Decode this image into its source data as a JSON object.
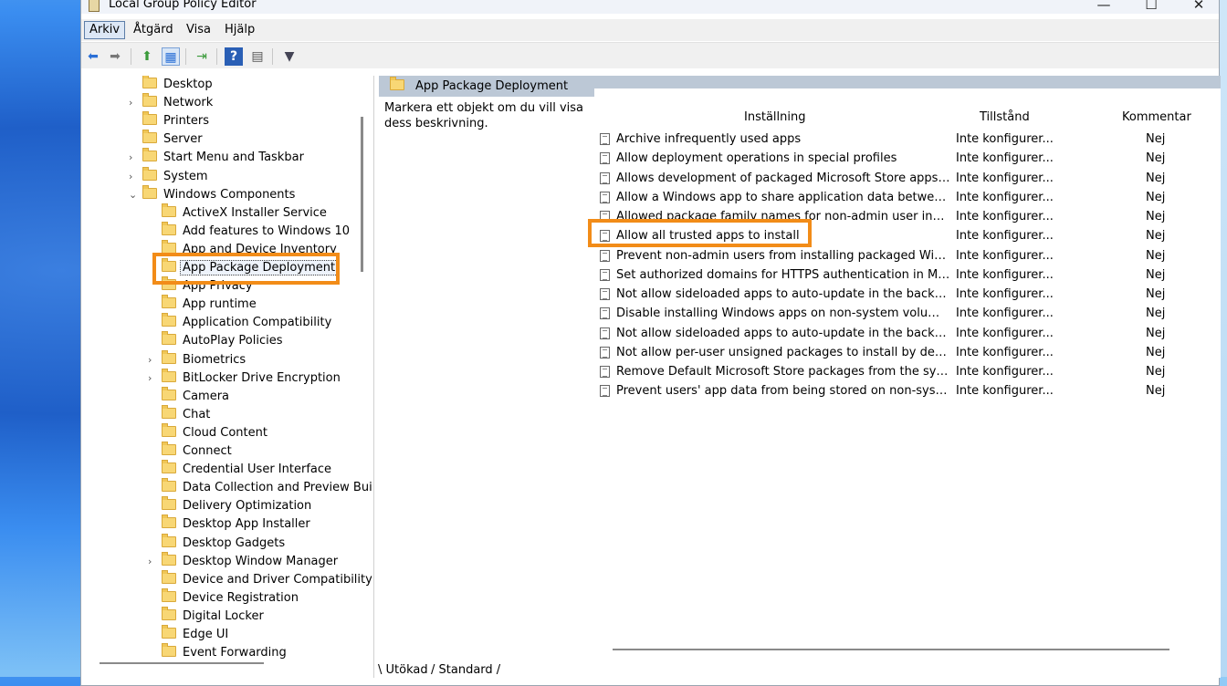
{
  "window": {
    "title": "Local Group Policy Editor",
    "minimize": "—",
    "maximize": "☐",
    "close": "✕"
  },
  "menu": {
    "items": [
      "Arkiv",
      "Åtgärd",
      "Visa",
      "Hjälp"
    ],
    "active": "Arkiv"
  },
  "toolbar": {
    "back": "⬅",
    "forward": "➡",
    "up": "⬆",
    "show_hide": "▦",
    "export": "⇥",
    "help": "?",
    "properties": "▤",
    "filter": "▼"
  },
  "tree": {
    "items": [
      {
        "label": "Desktop",
        "expander": ""
      },
      {
        "label": "Network",
        "expander": "›"
      },
      {
        "label": "Printers",
        "expander": ""
      },
      {
        "label": "Server",
        "expander": ""
      },
      {
        "label": "Start Menu and Taskbar",
        "expander": "›"
      },
      {
        "label": "System",
        "expander": "›"
      },
      {
        "label": "Windows Components",
        "expander": "⌄"
      },
      {
        "label": "ActiveX Installer Service",
        "expander": ""
      },
      {
        "label": "Add features to Windows 10",
        "expander": ""
      },
      {
        "label": "App and Device Inventory",
        "expander": ""
      },
      {
        "label": "App Package Deployment",
        "expander": ""
      },
      {
        "label": "App Privacy",
        "expander": ""
      },
      {
        "label": "App runtime",
        "expander": ""
      },
      {
        "label": "Application Compatibility",
        "expander": ""
      },
      {
        "label": "AutoPlay Policies",
        "expander": ""
      },
      {
        "label": "Biometrics",
        "expander": "›"
      },
      {
        "label": "BitLocker Drive Encryption",
        "expander": "›"
      },
      {
        "label": "Camera",
        "expander": ""
      },
      {
        "label": "Chat",
        "expander": ""
      },
      {
        "label": "Cloud Content",
        "expander": ""
      },
      {
        "label": "Connect",
        "expander": ""
      },
      {
        "label": "Credential User Interface",
        "expander": ""
      },
      {
        "label": "Data Collection and Preview Bui",
        "expander": ""
      },
      {
        "label": "Delivery Optimization",
        "expander": ""
      },
      {
        "label": "Desktop App Installer",
        "expander": ""
      },
      {
        "label": "Desktop Gadgets",
        "expander": ""
      },
      {
        "label": "Desktop Window Manager",
        "expander": "›"
      },
      {
        "label": "Device and Driver Compatibility",
        "expander": ""
      },
      {
        "label": "Device Registration",
        "expander": ""
      },
      {
        "label": "Digital Locker",
        "expander": ""
      },
      {
        "label": "Edge UI",
        "expander": ""
      },
      {
        "label": "Event Forwarding",
        "expander": ""
      }
    ],
    "selected": "App Package Deployment"
  },
  "content": {
    "header_title": "App Package Deployment",
    "description": "Markera ett objekt om du vill visa dess beskrivning.",
    "columns": {
      "setting": "Inställning",
      "state": "Tillstånd",
      "comment": "Kommentar"
    },
    "rows": [
      {
        "name": "Archive infrequently used apps",
        "state": "Inte konfigurer...",
        "comment": "Nej"
      },
      {
        "name": "Allow deployment operations in special profiles",
        "state": "Inte konfigurer...",
        "comment": "Nej"
      },
      {
        "name": "Allows development of packaged Microsoft Store apps and i...",
        "state": "Inte konfigurer...",
        "comment": "Nej"
      },
      {
        "name": "Allow a Windows app to share application data between users",
        "state": "Inte konfigurer...",
        "comment": "Nej"
      },
      {
        "name": "Allowed package family names for non-admin user install",
        "state": "Inte konfigurer...",
        "comment": "Nej"
      },
      {
        "name": "Allow all trusted apps to install",
        "state": "Inte konfigurer...",
        "comment": "Nej"
      },
      {
        "name": "Prevent non-admin users from installing packaged Window...",
        "state": "Inte konfigurer...",
        "comment": "Nej"
      },
      {
        "name": "Set authorized domains for HTTPS authentication in MSIX st...",
        "state": "Inte konfigurer...",
        "comment": "Nej"
      },
      {
        "name": "Not allow sideloaded apps to auto-update in the background",
        "state": "Inte konfigurer...",
        "comment": "Nej"
      },
      {
        "name": "Disable installing Windows apps on non-system volumes",
        "state": "Inte konfigurer...",
        "comment": "Nej"
      },
      {
        "name": "Not allow sideloaded apps to auto-update in the backgroun...",
        "state": "Inte konfigurer...",
        "comment": "Nej"
      },
      {
        "name": "Not allow per-user unsigned packages to install by default (r...",
        "state": "Inte konfigurer...",
        "comment": "Nej"
      },
      {
        "name": "Remove Default Microsoft Store packages from the system.",
        "state": "Inte konfigurer...",
        "comment": "Nej"
      },
      {
        "name": "Prevent users' app data from being stored on non-system v...",
        "state": "Inte konfigurer...",
        "comment": "Nej"
      }
    ]
  },
  "tabs": [
    "Utökad",
    "Standard"
  ],
  "colors": {
    "highlight": "#f28c18",
    "header_bg": "#bcc8d6"
  }
}
